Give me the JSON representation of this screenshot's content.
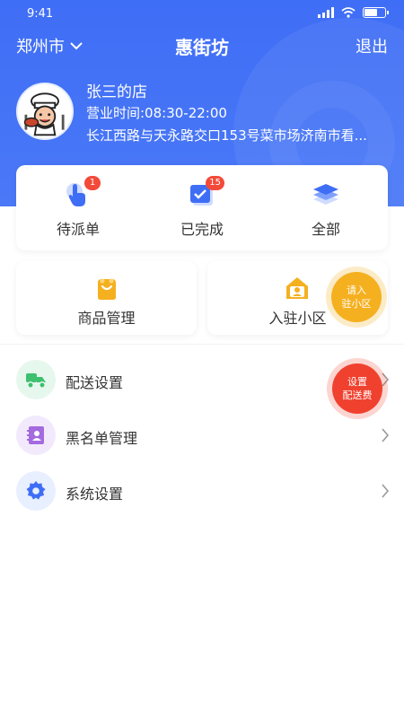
{
  "status_bar": {
    "time": "9:41"
  },
  "nav": {
    "city": "郑州市",
    "title": "惠街坊",
    "logout": "退出"
  },
  "shop": {
    "name": "张三的店",
    "hours": "营业时间:08:30-22:00",
    "address": "长江西路与天永路交口153号菜市场济南市看..."
  },
  "orders": [
    {
      "label": "待派单",
      "badge": "1",
      "icon": "tap-hand-icon"
    },
    {
      "label": "已完成",
      "badge": "15",
      "icon": "checkbox-icon"
    },
    {
      "label": "全部",
      "badge": "",
      "icon": "layers-icon"
    }
  ],
  "tiles": {
    "goods": {
      "label": "商品管理",
      "icon": "bag-icon"
    },
    "community": {
      "label": "入驻小区",
      "icon": "community-house-icon"
    }
  },
  "floaters": {
    "join_line1": "请入",
    "join_line2": "驻小区",
    "fee_line1": "设置",
    "fee_line2": "配送费"
  },
  "menu": [
    {
      "label": "配送设置",
      "icon": "delivery-scooter-icon"
    },
    {
      "label": "黑名单管理",
      "icon": "blacklist-book-icon"
    },
    {
      "label": "系统设置",
      "icon": "gear-icon"
    }
  ],
  "colors": {
    "primary": "#3f6ef6",
    "orange": "#f5b020",
    "red": "#f0412f",
    "green": "#3ec06f",
    "purple": "#a46ae0"
  }
}
